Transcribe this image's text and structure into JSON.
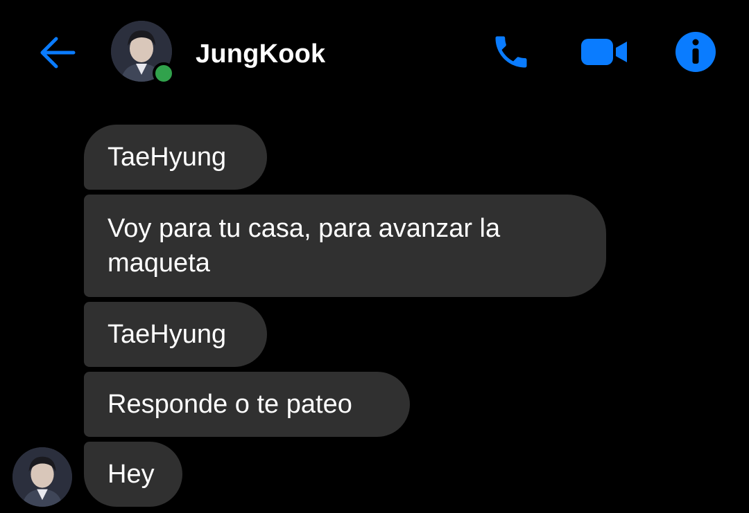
{
  "header": {
    "contact_name": "JungKook",
    "status": "online",
    "back_icon": "arrow-left-icon",
    "actions": [
      {
        "name": "voice-call",
        "icon": "phone-icon"
      },
      {
        "name": "video-call",
        "icon": "video-camera-icon"
      },
      {
        "name": "conversation-info",
        "icon": "info-icon"
      }
    ]
  },
  "messages": [
    {
      "sender": "JungKook",
      "text": "TaeHyung"
    },
    {
      "sender": "JungKook",
      "text": "Voy para tu casa, para avanzar la\nmaqueta"
    },
    {
      "sender": "JungKook",
      "text": "TaeHyung"
    },
    {
      "sender": "JungKook",
      "text": "Responde o te pateo"
    },
    {
      "sender": "JungKook",
      "text": "Hey"
    }
  ],
  "colors": {
    "background": "#000000",
    "accent": "#0a7cff",
    "bubble": "#303030",
    "online": "#31a24c",
    "text": "#ffffff"
  }
}
